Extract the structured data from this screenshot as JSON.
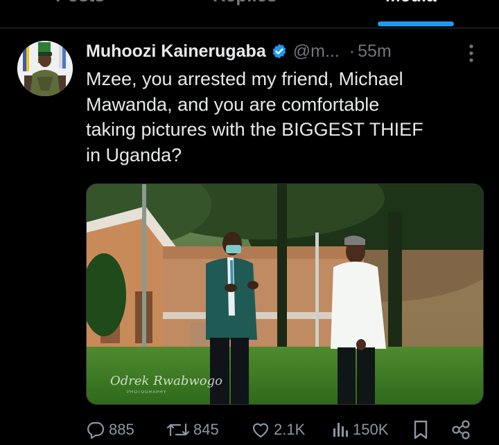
{
  "tabs": [
    {
      "label": "Posts",
      "active": false
    },
    {
      "label": "Replies",
      "active": false
    },
    {
      "label": "Media",
      "active": true
    }
  ],
  "tweet": {
    "author_name": "Muhoozi Kainerugaba",
    "handle": "@m...",
    "separator": "·",
    "time": "55m",
    "text_lines": [
      "Mzee, you arrested my friend, Michael",
      "Mawanda, and you are comfortable",
      "taking pictures with the BIGGEST THIEF",
      "in Uganda?"
    ],
    "image_watermark": "Odrek Rwabwogo",
    "image_watermark_sub": "PHOTOGRAPHY"
  },
  "actions": {
    "replies": "885",
    "reposts": "845",
    "likes": "2.1K",
    "views": "150K"
  },
  "colors": {
    "background": "#000000",
    "text": "#e7e9ea",
    "muted": "#71767b",
    "accent": "#1d9bf0",
    "border": "#2f3336"
  },
  "icons": {
    "verified": "verified-badge-icon",
    "more": "more-vertical-icon",
    "reply": "reply-icon",
    "repost": "repost-icon",
    "like": "heart-icon",
    "views": "views-icon",
    "bookmark": "bookmark-icon",
    "share": "share-icon"
  }
}
